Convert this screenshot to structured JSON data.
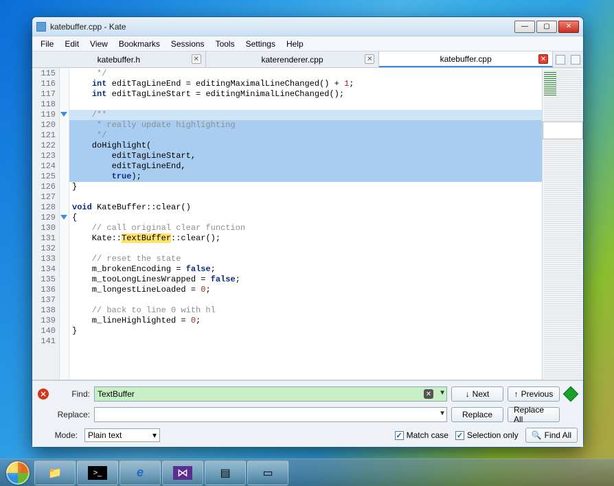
{
  "window": {
    "title": "katebuffer.cpp  - Kate",
    "controls": {
      "min": "—",
      "max": "▢",
      "close": "✕"
    }
  },
  "menu": [
    "File",
    "Edit",
    "View",
    "Bookmarks",
    "Sessions",
    "Tools",
    "Settings",
    "Help"
  ],
  "tabs": [
    {
      "label": "katebuffer.h",
      "active": false
    },
    {
      "label": "katerenderer.cpp",
      "active": false
    },
    {
      "label": "katebuffer.cpp",
      "active": true
    }
  ],
  "editor": {
    "first_line_no": 115,
    "fold_markers": [
      119,
      129
    ],
    "selection_range": [
      119,
      125
    ],
    "lines": [
      {
        "raw": "     */",
        "cls": "cm"
      },
      {
        "raw": "    int editTagLineEnd = editingMaximalLineChanged() + 1;"
      },
      {
        "raw": "    int editTagLineStart = editingMinimalLineChanged();"
      },
      {
        "raw": ""
      },
      {
        "raw": "    /**",
        "sel": "bar",
        "cls": "cm"
      },
      {
        "raw": "     * really update highlighting",
        "sel": "block",
        "cls": "cm"
      },
      {
        "raw": "     */",
        "sel": "block",
        "cls": "cm"
      },
      {
        "raw": "    doHighlight(",
        "sel": "block"
      },
      {
        "raw": "        editTagLineStart,",
        "sel": "block"
      },
      {
        "raw": "        editTagLineEnd,",
        "sel": "block"
      },
      {
        "raw": "        true);",
        "sel": "block"
      },
      {
        "raw": "}"
      },
      {
        "raw": ""
      },
      {
        "raw": "void KateBuffer::clear()"
      },
      {
        "raw": "{"
      },
      {
        "raw": "    // call original clear function",
        "cls": "cm"
      },
      {
        "raw": "    Kate::TextBuffer::clear();",
        "highlight": "TextBuffer"
      },
      {
        "raw": ""
      },
      {
        "raw": "    // reset the state",
        "cls": "cm"
      },
      {
        "raw": "    m_brokenEncoding = false;"
      },
      {
        "raw": "    m_tooLongLinesWrapped = false;"
      },
      {
        "raw": "    m_longestLineLoaded = 0;"
      },
      {
        "raw": ""
      },
      {
        "raw": "    // back to line 0 with hl",
        "cls": "cm"
      },
      {
        "raw": "    m_lineHighlighted = 0;"
      },
      {
        "raw": "}"
      },
      {
        "raw": ""
      }
    ]
  },
  "find": {
    "find_label": "Find:",
    "find_value": "TextBuffer",
    "replace_label": "Replace:",
    "replace_value": "",
    "next": "Next",
    "prev": "Previous",
    "replace_btn": "Replace",
    "replace_all": "Replace All",
    "mode_label": "Mode:",
    "mode_value": "Plain text",
    "match_case": "Match case",
    "selection_only": "Selection only",
    "find_all": "Find All"
  },
  "taskbar": {
    "items": [
      "folder",
      "terminal",
      "ie",
      "vs",
      "notepad",
      "explorer"
    ]
  }
}
